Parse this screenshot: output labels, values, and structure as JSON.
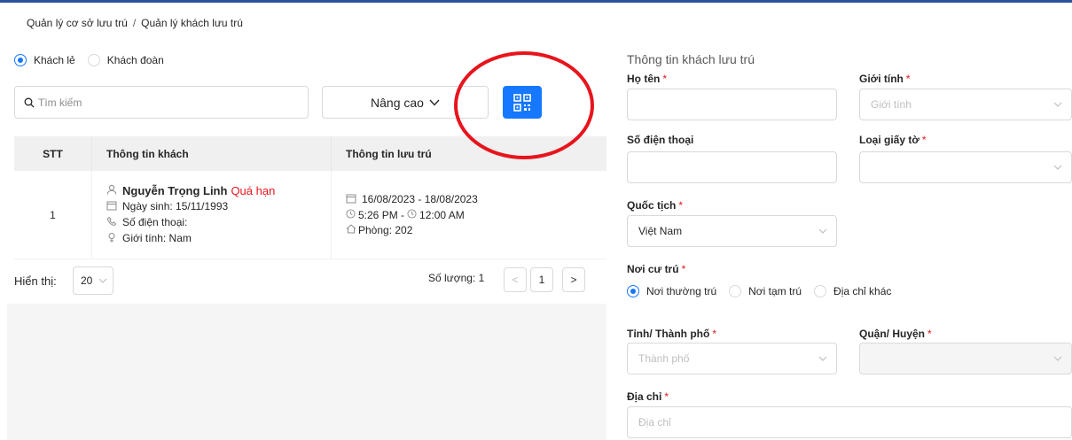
{
  "breadcrumb": {
    "items": [
      "Quản lý cơ sở lưu trú",
      "Quản lý khách lưu trú"
    ],
    "separator": "/"
  },
  "guest_type": {
    "options": [
      "Khách lẻ",
      "Khách đoàn"
    ],
    "selected": "Khách lẻ"
  },
  "search": {
    "placeholder": "Tìm kiếm",
    "value": ""
  },
  "advanced_button": {
    "label": "Nâng cao"
  },
  "qr_button": {
    "icon": "qr-code-icon"
  },
  "table": {
    "headers": [
      "STT",
      "Thông tin khách",
      "Thông tin lưu trú"
    ],
    "rows": [
      {
        "stt": "1",
        "name": "Nguyễn Trọng Linh",
        "status": "Quá hạn",
        "dob": "Ngày sinh: 15/11/1993",
        "phone": "Số điện thoại:",
        "gender": "Giới tính: Nam",
        "dates": "16/08/2023 - 18/08/2023",
        "time_in": "5:26 PM -",
        "time_out": "12:00 AM",
        "room": "Phòng: 202"
      }
    ]
  },
  "pagination": {
    "show_label": "Hiển thị:",
    "page_size": "20",
    "total_label": "Số lượng: 1",
    "current_page": "1",
    "prev": "<",
    "next": ">"
  },
  "form": {
    "title": "Thông tin khách lưu trú",
    "full_name": {
      "label": "Họ tên",
      "value": ""
    },
    "gender": {
      "label": "Giới tính",
      "placeholder": "Giới tính"
    },
    "phone": {
      "label": "Số điện thoại",
      "value": ""
    },
    "id_type": {
      "label": "Loại giấy tờ",
      "value": ""
    },
    "nationality": {
      "label": "Quốc tịch",
      "value": "Việt Nam"
    },
    "residence": {
      "label": "Nơi cư trú",
      "options": [
        "Nơi thường trú",
        "Nơi tạm trú",
        "Địa chỉ khác"
      ],
      "selected": "Nơi thường trú"
    },
    "province": {
      "label": "Tỉnh/ Thành phố",
      "placeholder": "Thành phố"
    },
    "district": {
      "label": "Quận/ Huyện",
      "value": ""
    },
    "address": {
      "label": "Địa chỉ",
      "placeholder": "Địa chỉ"
    },
    "required_mark": "*"
  },
  "colors": {
    "primary": "#1677ff",
    "danger": "#e8141b",
    "topbar": "#2a5299"
  }
}
